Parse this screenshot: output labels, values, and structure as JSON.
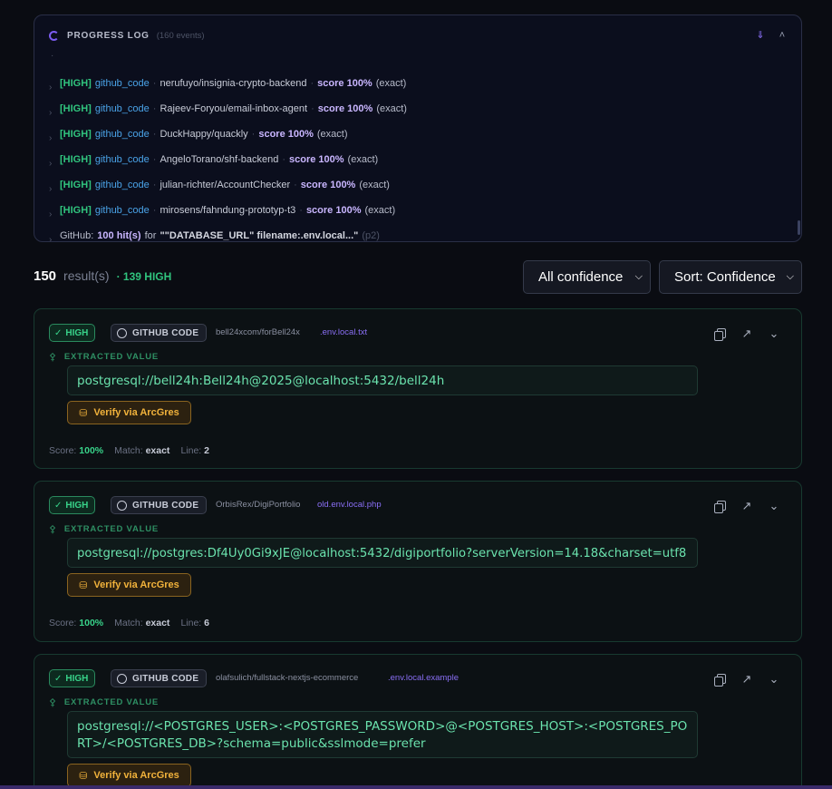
{
  "progress_log": {
    "title": "PROGRESS LOG",
    "count": "(160 events)",
    "lines": [
      {
        "tag": "[HIGH]",
        "source": "github_code",
        "repo": "nerufuyo/insignia-crypto-backend",
        "score": "score 100%",
        "match": "(exact)"
      },
      {
        "tag": "[HIGH]",
        "source": "github_code",
        "repo": "Rajeev-Foryou/email-inbox-agent",
        "score": "score 100%",
        "match": "(exact)"
      },
      {
        "tag": "[HIGH]",
        "source": "github_code",
        "repo": "DuckHappy/quackly",
        "score": "score 100%",
        "match": "(exact)"
      },
      {
        "tag": "[HIGH]",
        "source": "github_code",
        "repo": "AngeloTorano/shf-backend",
        "score": "score 100%",
        "match": "(exact)"
      },
      {
        "tag": "[HIGH]",
        "source": "github_code",
        "repo": "julian-richter/AccountChecker",
        "score": "score 100%",
        "match": "(exact)"
      },
      {
        "tag": "[HIGH]",
        "source": "github_code",
        "repo": "mirosens/fahndung-prototyp-t3",
        "score": "score 100%",
        "match": "(exact)"
      }
    ],
    "github_line": {
      "label": "GitHub:",
      "hits": "100 hit(s)",
      "for": "for",
      "query": "\"\"DATABASE_URL\" filename:.env.local...\"",
      "page": "(p2)"
    }
  },
  "results": {
    "count": "150",
    "label": "result(s)",
    "high": "· 139 HIGH"
  },
  "filters": {
    "confidence": "All confidence",
    "sort": "Sort: Confidence"
  },
  "cards": [
    {
      "badge": "HIGH",
      "source": "GITHUB CODE",
      "repo": "bell24xcom/forBell24x",
      "file": ".env.local.txt",
      "extracted_label": "EXTRACTED VALUE",
      "value": "postgresql://bell24h:Bell24h@2025@localhost:5432/bell24h",
      "verify": "Verify via ArcGres",
      "score_label": "Score:",
      "score": "100%",
      "match_label": "Match:",
      "match": "exact",
      "line_label": "Line:",
      "line": "2"
    },
    {
      "badge": "HIGH",
      "source": "GITHUB CODE",
      "repo": "OrbisRex/DigiPortfolio",
      "file": "old.env.local.php",
      "extracted_label": "EXTRACTED VALUE",
      "value": "postgresql://postgres:Df4Uy0Gi9xJE@localhost:5432/digiportfolio?serverVersion=14.18&charset=utf8",
      "verify": "Verify via ArcGres",
      "score_label": "Score:",
      "score": "100%",
      "match_label": "Match:",
      "match": "exact",
      "line_label": "Line:",
      "line": "6"
    },
    {
      "badge": "HIGH",
      "source": "GITHUB CODE",
      "repo": "olafsulich/fullstack-nextjs-ecommerce",
      "file": ".env.local.example",
      "extracted_label": "EXTRACTED VALUE",
      "value": "postgresql://<POSTGRES_USER>:<POSTGRES_PASSWORD>@<POSTGRES_HOST>:<POSTGRES_PORT>/<POSTGRES_DB>?schema=public&sslmode=prefer",
      "verify": "Verify via ArcGres"
    }
  ],
  "icons": {
    "spinner": "spinner-icon",
    "collapse_all": "double-chevron-down-icon",
    "collapse": "chevron-up-icon",
    "expand": "chevron-right-icon",
    "check": "check-circle-icon",
    "github": "github-icon",
    "copy": "copy-icon",
    "external": "external-link-icon",
    "card_expand": "chevron-down-icon",
    "key": "key-icon",
    "database": "database-icon"
  }
}
